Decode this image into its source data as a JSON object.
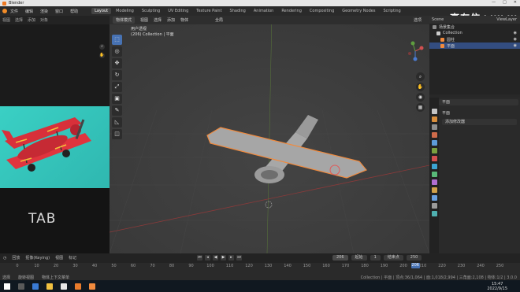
{
  "window": {
    "title": "Blender"
  },
  "menu": [
    "文件",
    "编辑",
    "渲染",
    "窗口",
    "帮助"
  ],
  "workspace_tabs": [
    "Layout",
    "Modeling",
    "Sculpting",
    "UV Editing",
    "Texture Paint",
    "Shading",
    "Animation",
    "Rendering",
    "Compositing",
    "Geometry Nodes",
    "Scripting"
  ],
  "active_workspace": "Layout",
  "scene": {
    "name": "Scene",
    "view_layer": "ViewLayer"
  },
  "watermark": {
    "text": "高有信",
    "brand": "bilibili"
  },
  "left_strip": {
    "header": [
      "视图",
      "选择",
      "添加",
      "对象"
    ],
    "overlay_label": "TAB"
  },
  "viewport": {
    "header": {
      "mode": "物体模式",
      "menus": [
        "视图",
        "选择",
        "添加",
        "物体"
      ],
      "global": "全局"
    },
    "info": {
      "line1": "用户透视",
      "line2": "(206) Collection | 平面"
    },
    "tools": [
      "select",
      "cursor",
      "move",
      "rotate",
      "scale",
      "transform",
      "annotate",
      "measure",
      "add-cube"
    ],
    "options_label": "选项"
  },
  "outliner": {
    "header": "场景集合",
    "rows": [
      {
        "label": "场景集合",
        "color": "#8c8c8c"
      },
      {
        "label": "Collection",
        "color": "#cccccc"
      },
      {
        "label": "圆柱",
        "color": "#f08a3e"
      },
      {
        "label": "平面",
        "color": "#f08a3e",
        "selected": true
      }
    ]
  },
  "properties": {
    "object_name": "平面",
    "rows": [
      "平面",
      "添加修改器"
    ],
    "tab_colors": [
      "#c4c4c4",
      "#d98e3c",
      "#8e8e8e",
      "#cf6b4a",
      "#5d9bd8",
      "#7a9f3f",
      "#d35050",
      "#3ca3d2",
      "#58b878",
      "#b06ed0",
      "#d1a04a",
      "#6aa0e0",
      "#9b9b9b",
      "#4fb0b0"
    ]
  },
  "timeline": {
    "header": [
      "回放",
      "抠像(Keying)",
      "视图",
      "标记"
    ],
    "current_frame": "206",
    "start": "1",
    "end": "250",
    "start_label": "起始",
    "end_label": "结束点",
    "ticks": [
      "0",
      "10",
      "20",
      "30",
      "40",
      "50",
      "60",
      "70",
      "80",
      "90",
      "100",
      "110",
      "120",
      "130",
      "140",
      "150",
      "160",
      "170",
      "180",
      "190",
      "200",
      "210",
      "220",
      "230",
      "240",
      "250"
    ]
  },
  "status": {
    "select": "选择",
    "rotate": "旋转视图",
    "menu": "物体上下文菜单",
    "stats": "Collection | 平面 | 顶点:36/1,064 | 面:1,018/2,994 | 三角面:2,108 | 物体:1/2 | 3.0.0"
  },
  "taskbar": {
    "time": "15:47",
    "date": "2022/9/15",
    "icon_colors": [
      "#ffffff",
      "#5a5a5a",
      "#3a7bd5",
      "#f0c040",
      "#e8e8e8",
      "#e87b2c",
      "#f08a3e"
    ]
  }
}
